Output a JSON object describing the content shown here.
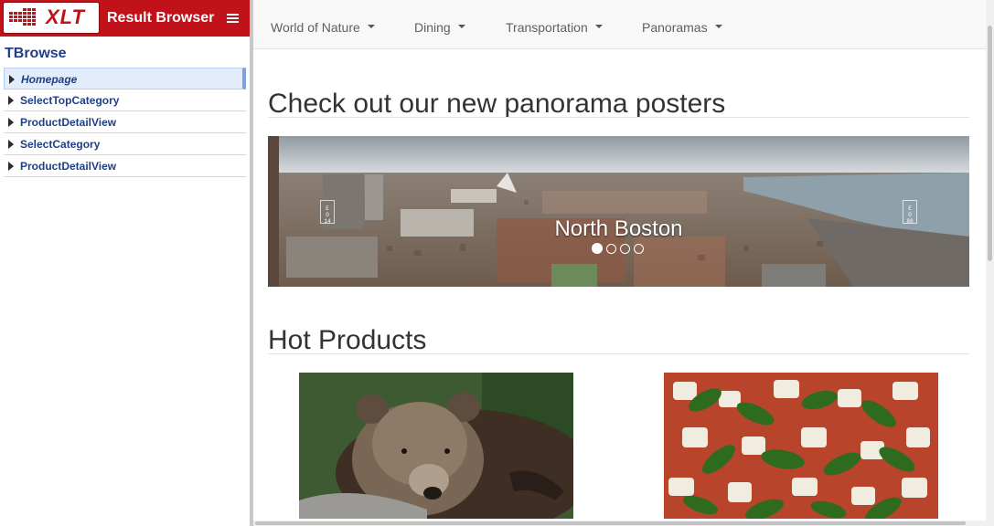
{
  "brand": {
    "logo_text": "XLT",
    "app_title": "Result Browser",
    "menu_icon": "hamburger-icon",
    "brand_color": "#c1121a"
  },
  "sidebar": {
    "title": "TBrowse",
    "items": [
      {
        "label": "Homepage",
        "active": true
      },
      {
        "label": "SelectTopCategory",
        "active": false
      },
      {
        "label": "ProductDetailView",
        "active": false
      },
      {
        "label": "SelectCategory",
        "active": false
      },
      {
        "label": "ProductDetailView",
        "active": false
      }
    ]
  },
  "page": {
    "nav": [
      {
        "label": "World of Nature"
      },
      {
        "label": "Dining"
      },
      {
        "label": "Transportation"
      },
      {
        "label": "Panoramas"
      }
    ],
    "panorama_heading": "Check out our new panorama posters",
    "carousel": {
      "caption": "North Boston",
      "slide_count": 4,
      "active_slide": 1
    },
    "hot_products_heading": "Hot Products",
    "products": [
      {
        "image": "grizzly-bear-photo"
      },
      {
        "image": "caprese-salad-photo"
      }
    ]
  }
}
